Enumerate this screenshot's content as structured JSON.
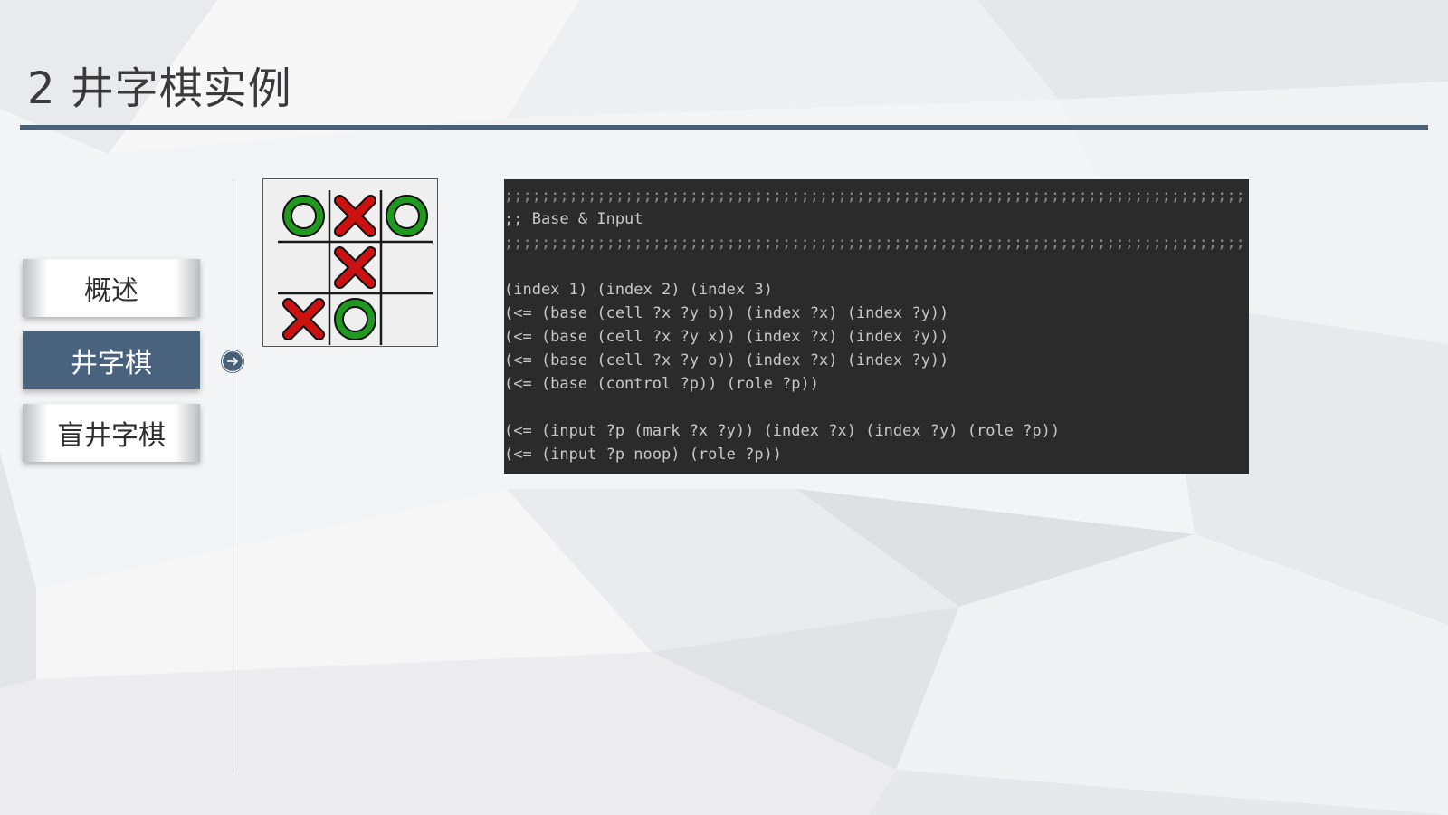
{
  "slide": {
    "title": "2 井字棋实例"
  },
  "nav": {
    "items": [
      {
        "label": "概述",
        "active": false
      },
      {
        "label": "井字棋",
        "active": true
      },
      {
        "label": "盲井字棋",
        "active": false
      }
    ],
    "arrow_icon": "arrow-right-circle-icon"
  },
  "board": {
    "cells": [
      [
        "O",
        "X",
        "O"
      ],
      [
        "",
        "X",
        ""
      ],
      [
        "X",
        "O",
        ""
      ]
    ],
    "colors": {
      "o": "#1f9a1f",
      "x": "#cc1111"
    }
  },
  "code": {
    "lines": [
      ";;;;;;;;;;;;;;;;;;;;;;;;;;;;;;;;;;;;;;;;;;;;;;;;;;;;;;;;;;;;;;;;;;;;;;;;;;;;;;;;;;;;;;;",
      ";; Base & Input",
      ";;;;;;;;;;;;;;;;;;;;;;;;;;;;;;;;;;;;;;;;;;;;;;;;;;;;;;;;;;;;;;;;;;;;;;;;;;;;;;;;;;;;;;;",
      "",
      "(index 1) (index 2) (index 3)",
      "(<= (base (cell ?x ?y b)) (index ?x) (index ?y))",
      "(<= (base (cell ?x ?y x)) (index ?x) (index ?y))",
      "(<= (base (cell ?x ?y o)) (index ?x) (index ?y))",
      "(<= (base (control ?p)) (role ?p))",
      "",
      "(<= (input ?p (mark ?x ?y)) (index ?x) (index ?y) (role ?p))",
      "(<= (input ?p noop) (role ?p))"
    ]
  },
  "colors": {
    "accent": "#4a6078",
    "code_bg": "#2b2b2b"
  }
}
